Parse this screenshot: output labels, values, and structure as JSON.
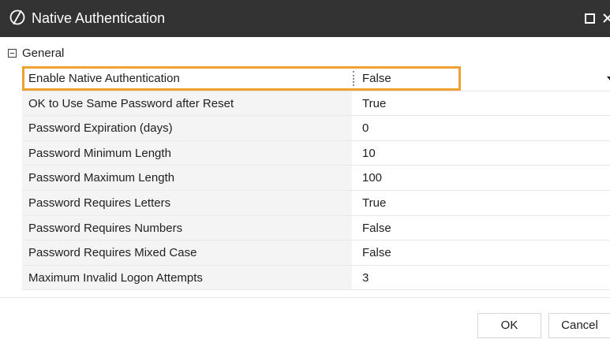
{
  "window": {
    "title": "Native Authentication",
    "icon": "slashed-circle-icon",
    "titlebar_color": "#333333",
    "controls": [
      "maximize-icon",
      "close-icon"
    ]
  },
  "section": {
    "label": "General",
    "collapse_symbol": "minus-box-icon"
  },
  "properties": [
    {
      "name": "Enable Native Authentication",
      "value": "False",
      "selected": true,
      "editor": "dropdown"
    },
    {
      "name": "OK to Use Same Password after Reset",
      "value": "True"
    },
    {
      "name": "Password Expiration (days)",
      "value": "0"
    },
    {
      "name": "Password Minimum Length",
      "value": "10"
    },
    {
      "name": "Password Maximum Length",
      "value": "100"
    },
    {
      "name": "Password Requires Letters",
      "value": "True"
    },
    {
      "name": "Password Requires Numbers",
      "value": "False"
    },
    {
      "name": "Password Requires Mixed Case",
      "value": "False"
    },
    {
      "name": "Maximum Invalid Logon Attempts",
      "value": "3"
    }
  ],
  "highlight_color": "#f0a030",
  "buttons": {
    "ok_label": "OK",
    "cancel_label": "Cancel"
  }
}
